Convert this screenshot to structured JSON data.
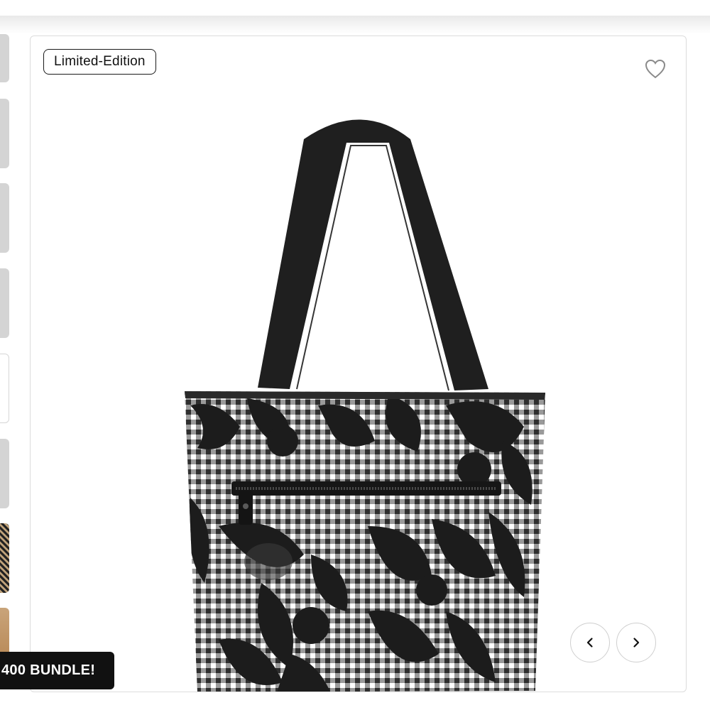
{
  "badge": {
    "label": "Limited-Edition"
  },
  "favorite": {
    "icon": "heart-outline-icon"
  },
  "gallery": {
    "prev_icon": "chevron-left-icon",
    "next_icon": "chevron-right-icon",
    "image": "black-white-gingham-tote-bag"
  },
  "promo": {
    "label": "400 BUNDLE!"
  },
  "colors": {
    "accent": "#111111",
    "border": "#dcdcdc",
    "thumb_placeholder": "#d4d4d4"
  }
}
